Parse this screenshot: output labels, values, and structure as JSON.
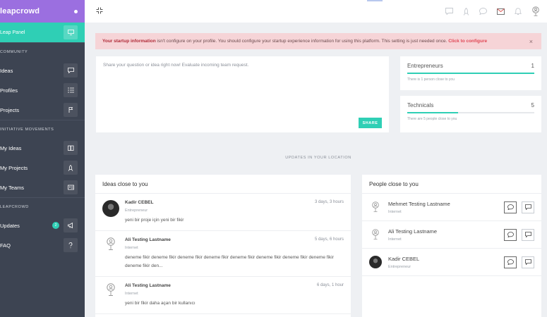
{
  "brand": {
    "logo": "leapcrowd"
  },
  "sidebar": {
    "panel_label": "Leap Panel",
    "sections": [
      {
        "title": "COMMUNITY",
        "items": [
          {
            "label": "Ideas",
            "icon": "chat-icon"
          },
          {
            "label": "Profiles",
            "icon": "list-icon"
          },
          {
            "label": "Projects",
            "icon": "flag-icon"
          }
        ]
      },
      {
        "title": "INITIATIVE MOVEMENTS",
        "items": [
          {
            "label": "My Ideas",
            "icon": "book-icon"
          },
          {
            "label": "My Projects",
            "icon": "rocket-icon"
          },
          {
            "label": "My Teams",
            "icon": "id-card-icon"
          }
        ]
      },
      {
        "title": "LEAPCROWD",
        "items": [
          {
            "label": "Updates",
            "badge": "2",
            "icon": "megaphone-icon"
          },
          {
            "label": "FAQ",
            "icon": "question-icon"
          }
        ]
      }
    ]
  },
  "alert": {
    "bold": "Your startup information",
    "text": " isn't configure on your profile. You should configure your startup experience information for using this platform. This setting is just needed once. ",
    "link": "Click to configure",
    "close": "×"
  },
  "share": {
    "placeholder": "Share your question or idea right now! Evaluate incoming team request.",
    "button": "SHARE"
  },
  "stats": [
    {
      "label": "Entrepreneurs",
      "count": "1",
      "sub": "There is 1 person close to you",
      "fill": 1.0
    },
    {
      "label": "Technicals",
      "count": "5",
      "sub": "There are 5 people close to you",
      "fill": 0.4
    }
  ],
  "updates_label": "UPDATES IN YOUR LOCATION",
  "ideas": {
    "title": "Ideas close to you",
    "items": [
      {
        "name": "Kadir CEBEL",
        "role": "Entrepreneur",
        "time": "3 days, 3 hours",
        "text": "yeni bir proje için yeni bir fikir",
        "avatar": "photo"
      },
      {
        "name": "Ali Testing Lastname",
        "role": "Internet",
        "time": "5 days, 6 hours",
        "text": "deneme fikir deneme fikir deneme fikir deneme fikir deneme fikir deneme fikir deneme fikir deneme fikir deneme fikir den...",
        "avatar": "placeholder"
      },
      {
        "name": "Ali Testing Lastname",
        "role": "Internet",
        "time": "6 days, 1 hour",
        "text": "yeni bir fikir daha açan bir kullanıcı",
        "avatar": "placeholder"
      }
    ]
  },
  "people": {
    "title": "People close to you",
    "items": [
      {
        "name": "Mehmet Testing Lastname",
        "role": "Internet",
        "avatar": "placeholder"
      },
      {
        "name": "Ali Testing Lastname",
        "role": "Internet",
        "avatar": "placeholder"
      },
      {
        "name": "Kadir CEBEL",
        "role": "Entrepreneur",
        "avatar": "photo"
      }
    ]
  },
  "colors": {
    "brand": "#9b6fe0",
    "accent": "#2fcfb5",
    "sidebar": "#3d4452",
    "alert_bg": "#f6d4d7",
    "alert_link": "#e04654"
  }
}
